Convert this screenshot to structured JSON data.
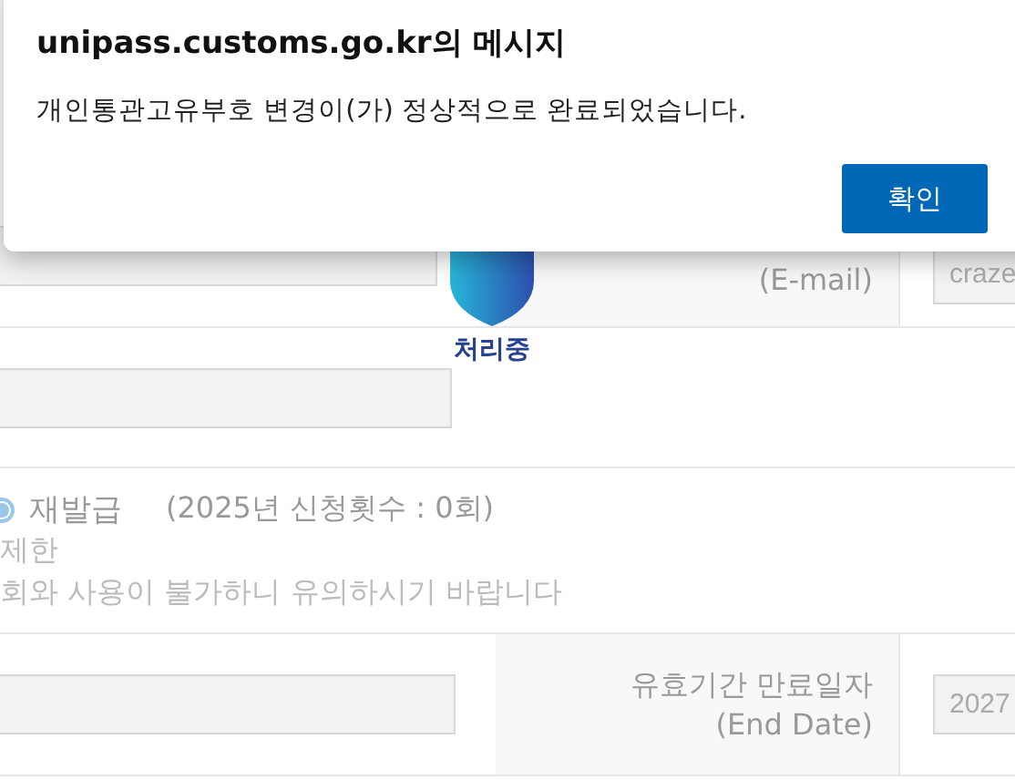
{
  "dialog": {
    "title": "unipass.customs.go.kr의 메시지",
    "message": "개인통관고유부호 변경이(가) 정상적으로 완료되었습니다.",
    "button": "확인"
  },
  "loading": {
    "label": "처리중"
  },
  "email_row": {
    "label": "(E-mail)",
    "value": "craze"
  },
  "reissue": {
    "option": {
      "label": "재발급",
      "selected": true
    },
    "count_note": "(2025년 신청횟수 : 0회)",
    "notes": [
      "제한",
      "회와 사용이 불가하니 유의하시기 바랍니다"
    ]
  },
  "end_date_row": {
    "label": "유효기간 만료일자",
    "sublabel": "(End Date)",
    "value": "2027"
  }
}
